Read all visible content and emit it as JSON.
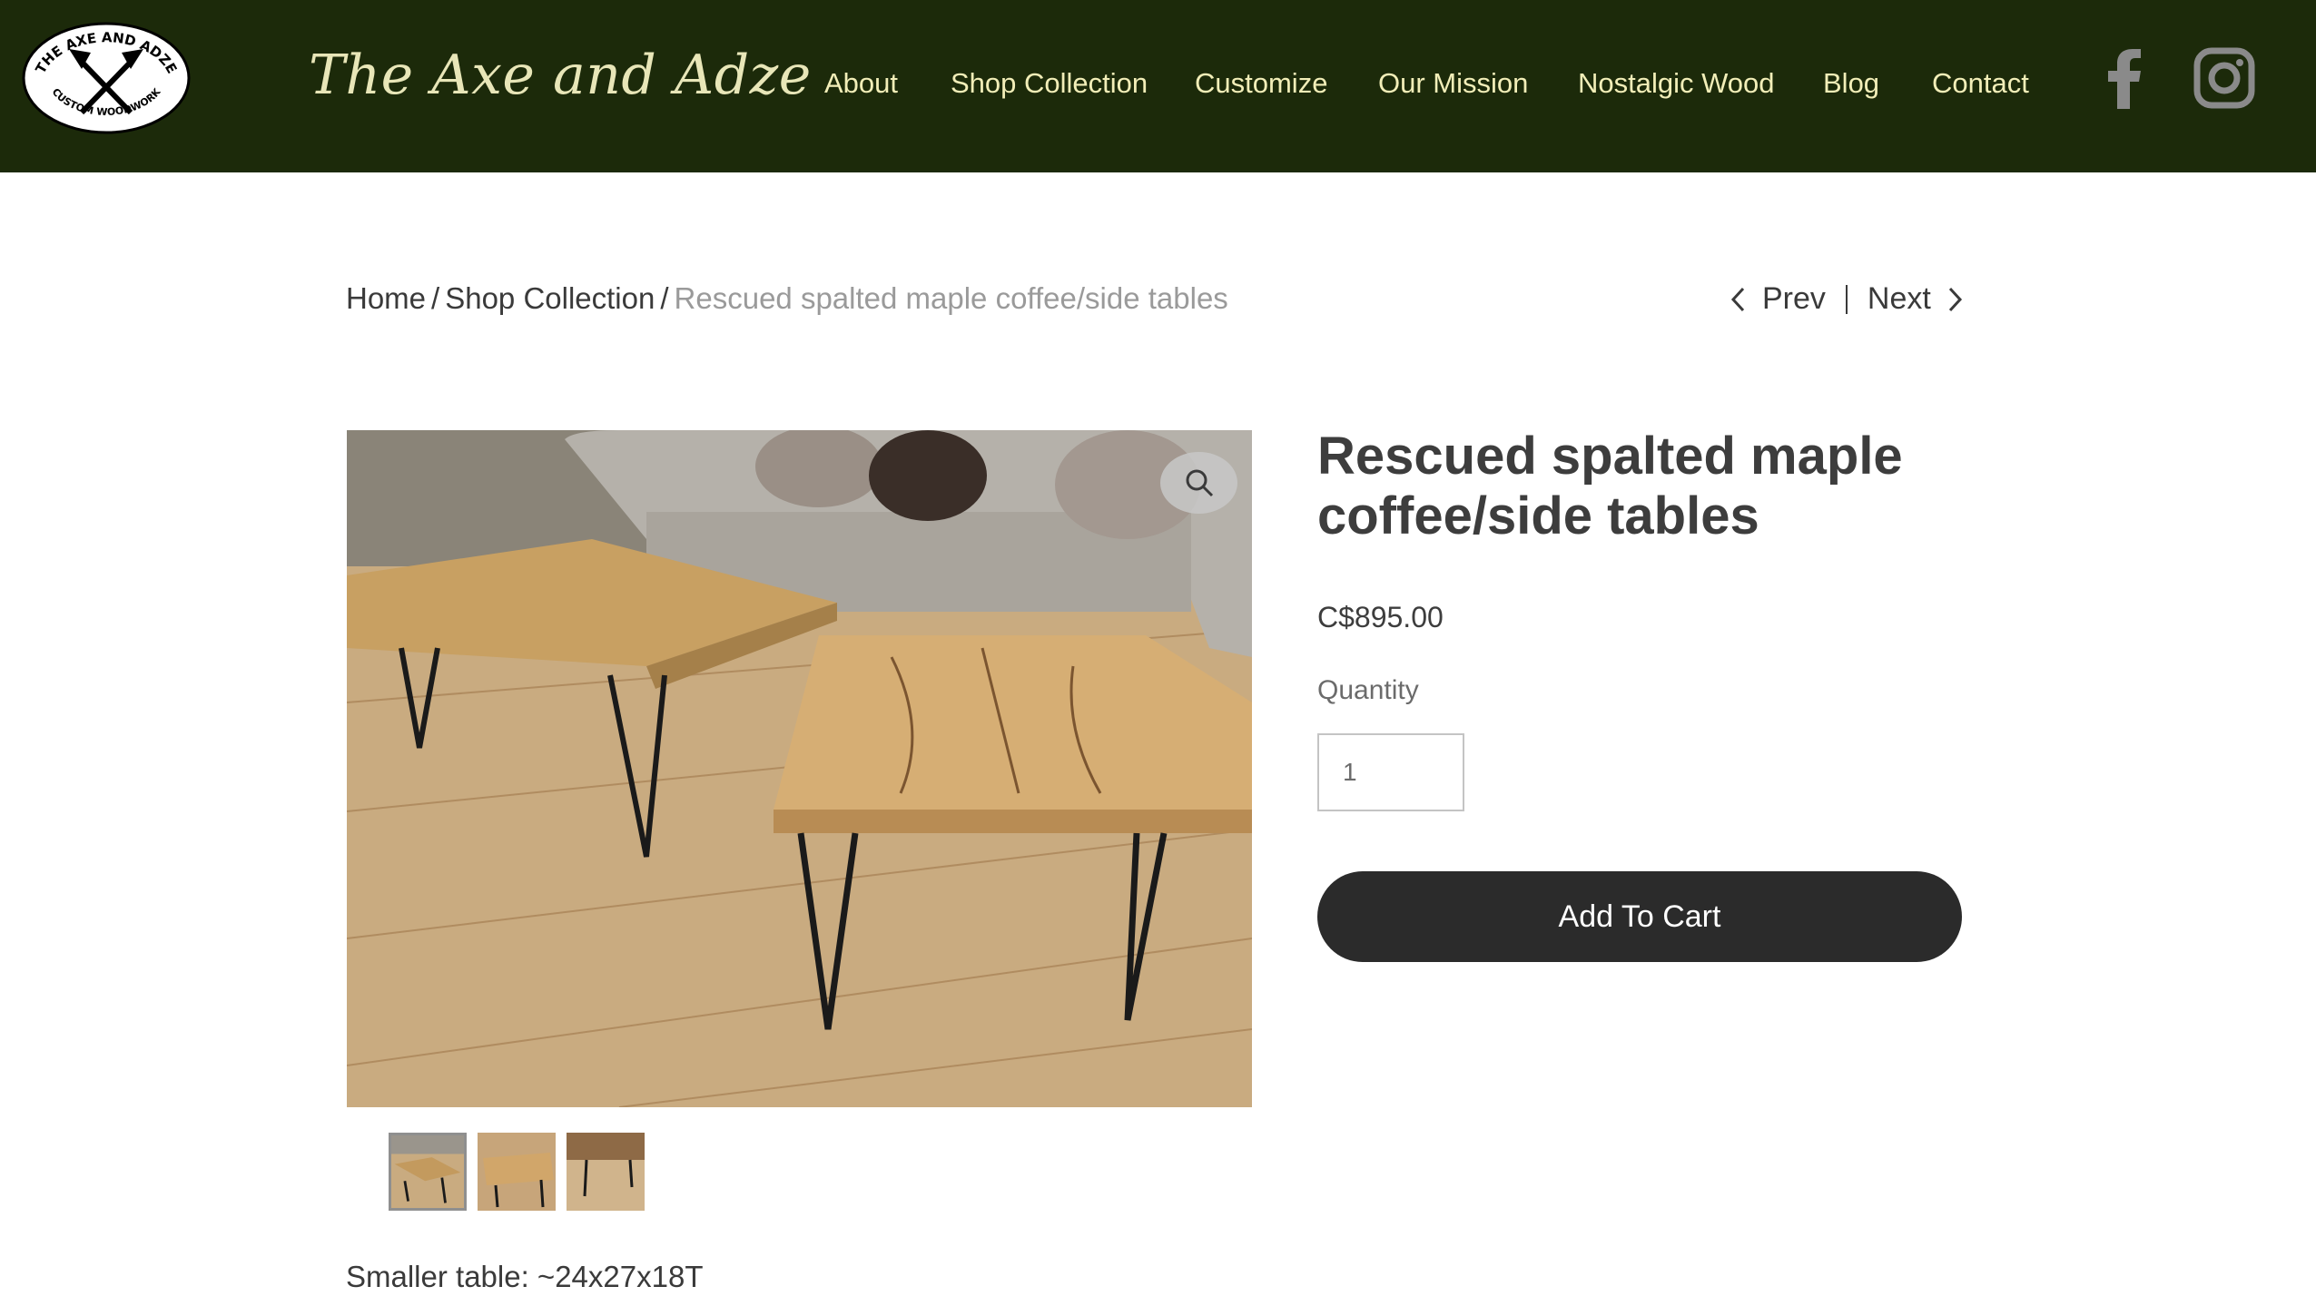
{
  "site": {
    "title": "The Axe and Adze",
    "logo_text_top": "THE AXE AND ADZE",
    "logo_text_bottom": "CUSTOM WOODWORK",
    "nav": [
      "About",
      "Shop Collection",
      "Customize",
      "Our Mission",
      "Nostalgic Wood",
      "Blog",
      "Contact"
    ],
    "social": [
      "facebook-icon",
      "instagram-icon"
    ],
    "colors": {
      "header_bg": "#1c2a0a",
      "nav_text": "#f2eeb8",
      "button_bg": "#2b2b2b"
    }
  },
  "breadcrumb": {
    "home": "Home",
    "separator": "/",
    "section": "Shop Collection",
    "current": "Rescued spalted maple coffee/side tables"
  },
  "pager": {
    "prev": "Prev",
    "next": "Next"
  },
  "product": {
    "name": "Rescued spalted maple coffee/side tables",
    "price": "C$895.00",
    "quantity_label": "Quantity",
    "quantity_value": "1",
    "add_to_cart": "Add To Cart",
    "description_first_line": "Smaller table: ~24x27x18T",
    "thumbnails": 3
  }
}
